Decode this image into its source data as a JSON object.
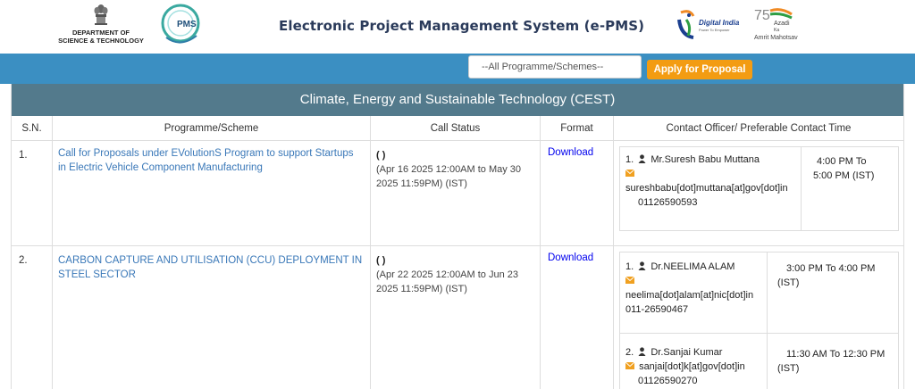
{
  "header": {
    "dept_line1": "DEPARTMENT OF",
    "dept_line2": "SCIENCE & TECHNOLOGY",
    "pms_logo_text": "PMS",
    "title": "Electronic Project Management System (e-PMS)",
    "digital_india_text": "Digital India",
    "digital_india_tagline": "Power To Empower",
    "azadi_line1": "Azadi",
    "azadi_line2": "Ka",
    "azadi_line3": "Amrit Mahotsav",
    "azadi_number": "75"
  },
  "toolbar": {
    "programme_select": "--All Programme/Schemes--",
    "apply_label": "Apply for Proposal"
  },
  "section": {
    "title": "Climate, Energy and Sustainable Technology (CEST)"
  },
  "table": {
    "headers": [
      "S.N.",
      "Programme/Scheme",
      "Call Status",
      "Format",
      "Contact Officer/ Preferable Contact Time"
    ],
    "rows": [
      {
        "sn": "1.",
        "programme_line1": "Call for Proposals under EVolutionS Program to support Startups",
        "programme_line2": "in Electric Vehicle Component Manufacturing",
        "status_paren": "(          )",
        "status_line1": "(Apr 16 2025 12:00AM to May 30",
        "status_line2": "2025 11:59PM) (IST)",
        "format": "Download",
        "contacts": [
          {
            "index": "1.",
            "name": "Mr.Suresh Babu Muttana",
            "email": "sureshbabu[dot]muttana[at]gov[dot]in",
            "phone": "01126590593",
            "time_line1": "4:00 PM To",
            "time_line2": "5:00 PM (IST)"
          }
        ]
      },
      {
        "sn": "2.",
        "programme_line1": "CARBON CAPTURE AND UTILISATION (CCU) DEPLOYMENT IN",
        "programme_line2": "STEEL SECTOR",
        "status_paren": "(          )",
        "status_line1": "(Apr 22 2025 12:00AM to Jun 23",
        "status_line2": "2025 11:59PM) (IST)",
        "format": "Download",
        "contacts": [
          {
            "index": "1.",
            "name": "Dr.NEELIMA ALAM",
            "email": "neelima[dot]alam[at]nic[dot]in",
            "phone": "011-26590467",
            "time_line1": "3:00 PM To 4:00 PM",
            "time_line2": "(IST)"
          },
          {
            "index": "2.",
            "name": "Dr.Sanjai Kumar",
            "email": "sanjai[dot]k[at]gov[dot]in",
            "phone": "01126590270",
            "time_line1": "11:30 AM To 12:30 PM",
            "time_line2": "(IST)"
          }
        ]
      }
    ]
  },
  "colors": {
    "bluebar": "#3b8fc2",
    "section_header": "#537a8c",
    "apply_button": "#f39c12",
    "link": "#3a78b8",
    "mail_icon": "#f0a020"
  }
}
